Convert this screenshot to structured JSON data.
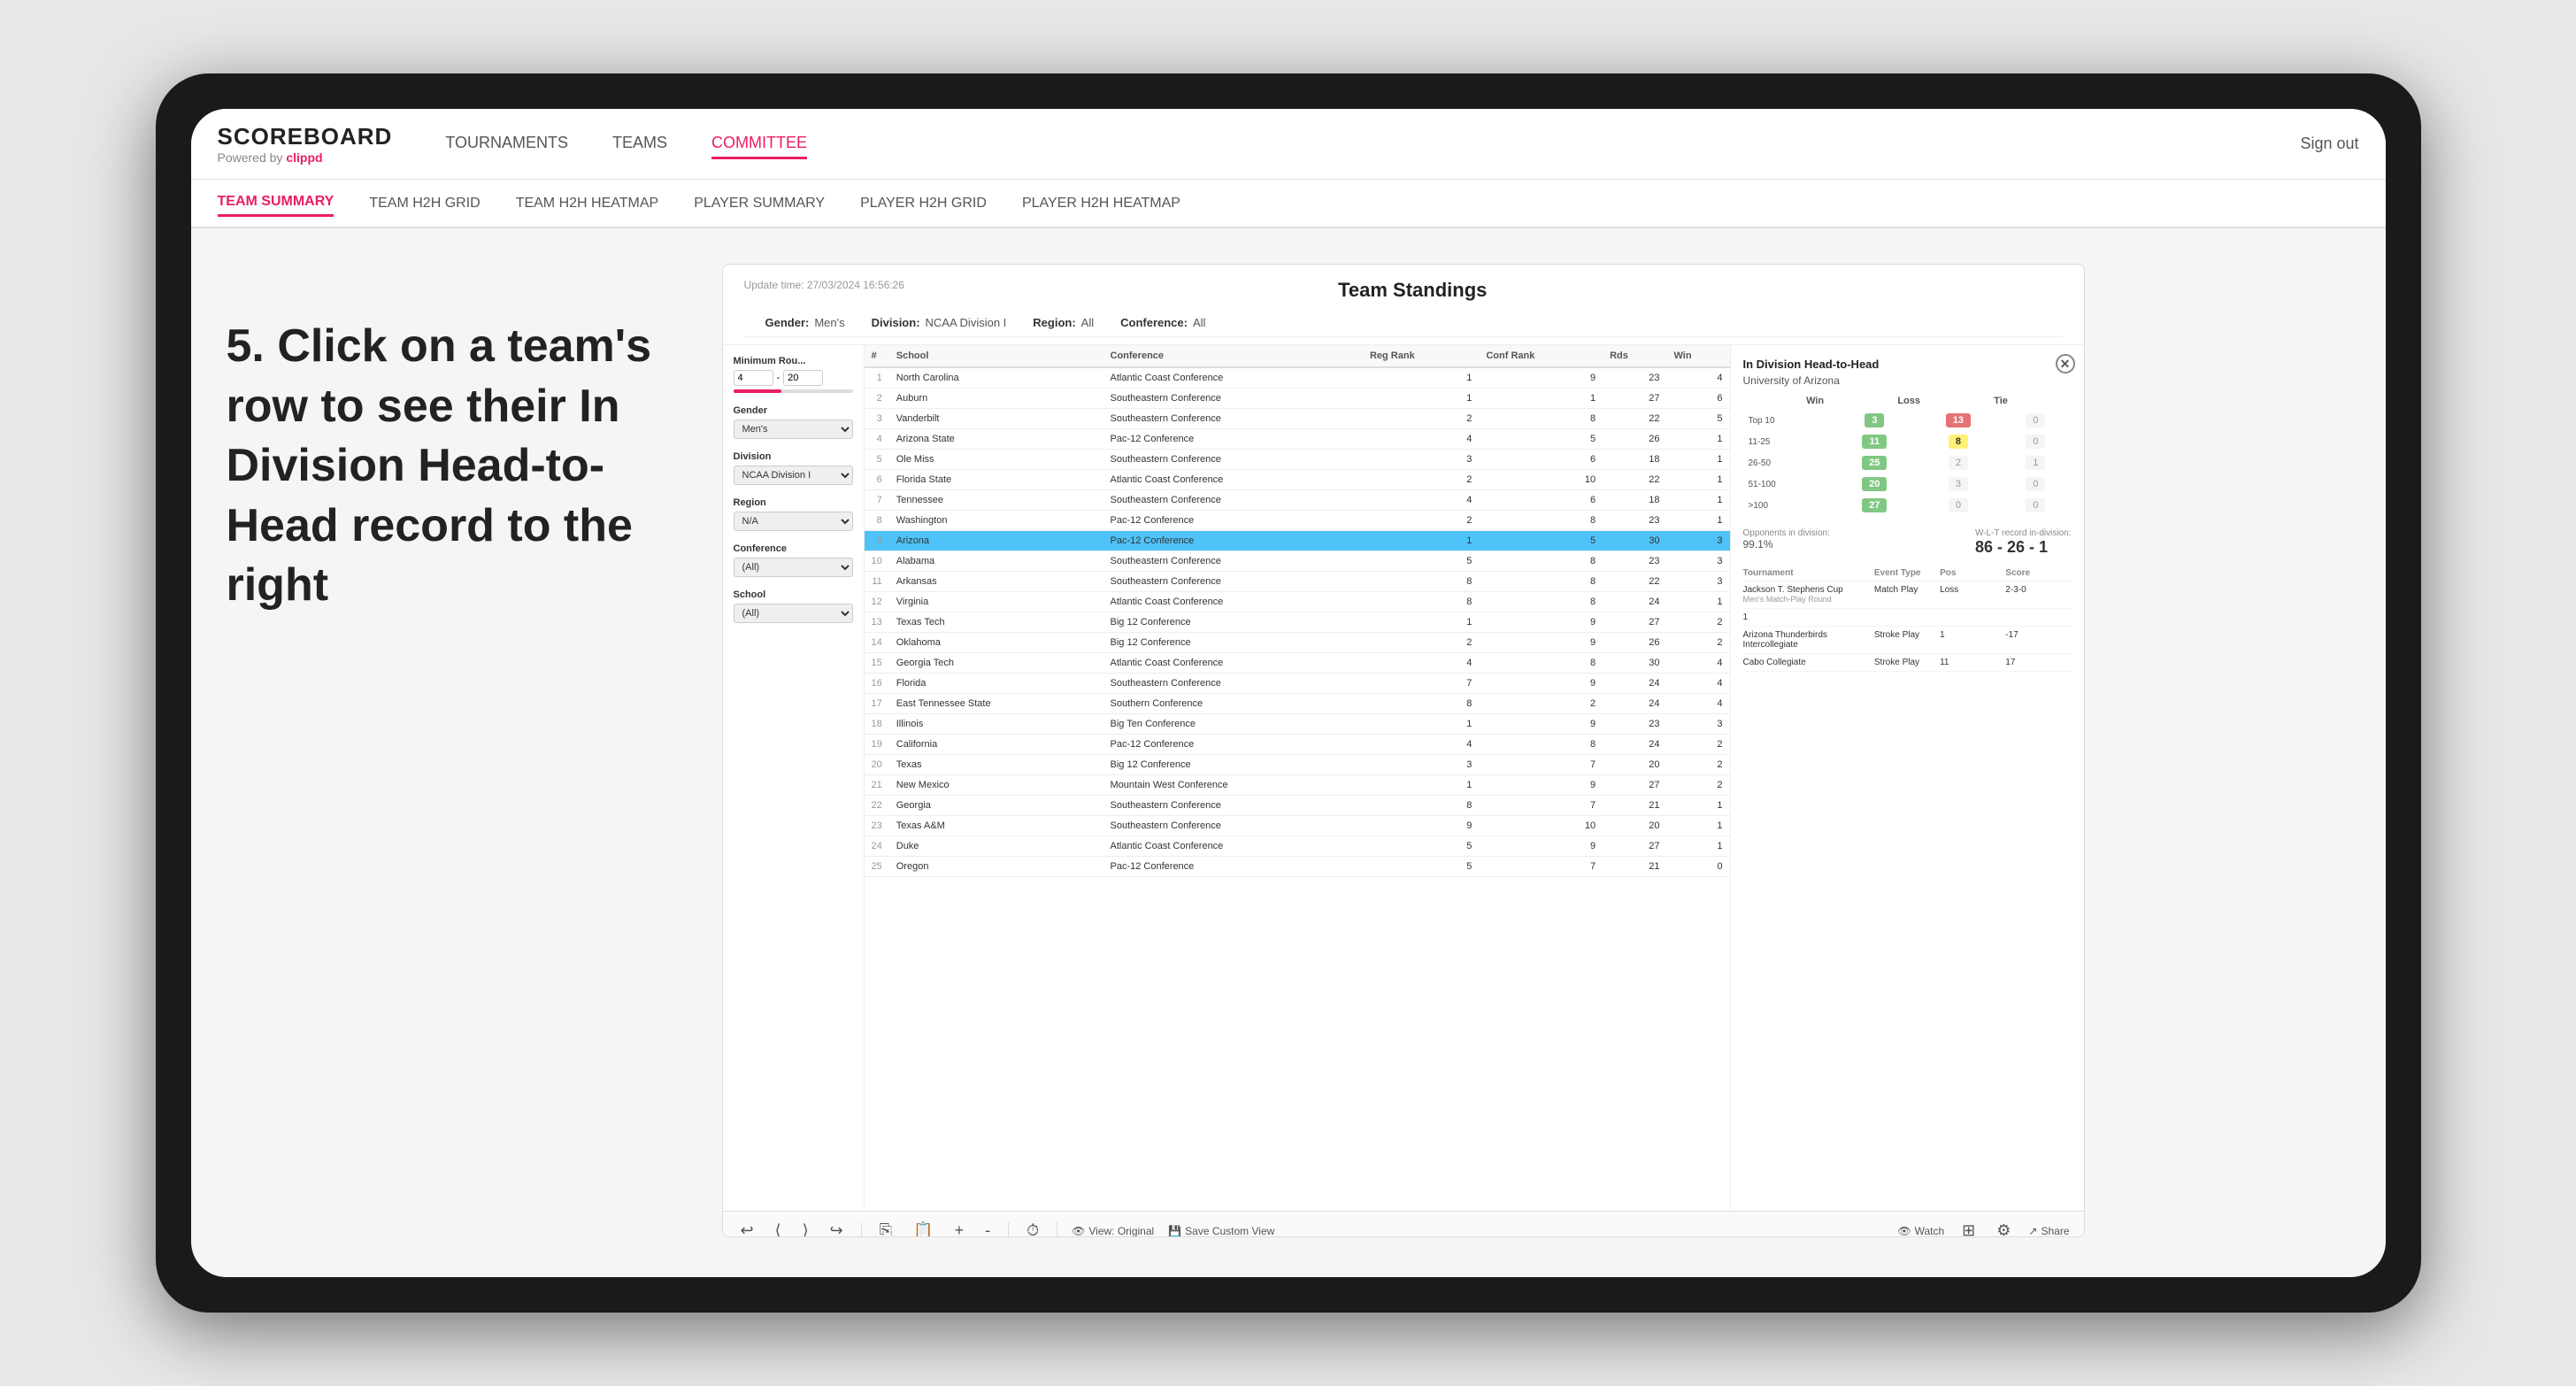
{
  "app": {
    "logo": "SCOREBOARD",
    "logo_sub": "Powered by",
    "logo_brand": "clippd",
    "sign_out": "Sign out"
  },
  "nav": {
    "links": [
      {
        "label": "TOURNAMENTS",
        "active": false
      },
      {
        "label": "TEAMS",
        "active": false
      },
      {
        "label": "COMMITTEE",
        "active": true
      }
    ]
  },
  "sub_nav": {
    "links": [
      {
        "label": "TEAM SUMMARY",
        "active": true
      },
      {
        "label": "TEAM H2H GRID",
        "active": false
      },
      {
        "label": "TEAM H2H HEATMAP",
        "active": false
      },
      {
        "label": "PLAYER SUMMARY",
        "active": false
      },
      {
        "label": "PLAYER H2H GRID",
        "active": false
      },
      {
        "label": "PLAYER H2H HEATMAP",
        "active": false
      }
    ]
  },
  "annotation": "5. Click on a team's row to see their In Division Head-to-Head record to the right",
  "panel": {
    "update_time": "Update time: 27/03/2024 16:56:26",
    "title": "Team Standings",
    "filters": {
      "gender": "Men's",
      "division": "NCAA Division I",
      "region": "All",
      "conference": "All"
    },
    "sidebar": {
      "min_rounds_label": "Minimum Rou...",
      "min_val": "4",
      "max_val": "20",
      "gender_label": "Gender",
      "gender_value": "Men's",
      "division_label": "Division",
      "division_value": "NCAA Division I",
      "region_label": "Region",
      "region_value": "N/A",
      "conference_label": "Conference",
      "conference_value": "(All)",
      "school_label": "School",
      "school_value": "(All)"
    },
    "table_headers": [
      "#",
      "School",
      "Conference",
      "Reg Rank",
      "Conf Rank",
      "Rds",
      "Win"
    ],
    "teams": [
      {
        "rank": 1,
        "school": "North Carolina",
        "conference": "Atlantic Coast Conference",
        "reg_rank": 1,
        "conf_rank": 9,
        "rds": 23,
        "win": 4
      },
      {
        "rank": 2,
        "school": "Auburn",
        "conference": "Southeastern Conference",
        "reg_rank": 1,
        "conf_rank": 1,
        "rds": 27,
        "win": 6
      },
      {
        "rank": 3,
        "school": "Vanderbilt",
        "conference": "Southeastern Conference",
        "reg_rank": 2,
        "conf_rank": 8,
        "rds": 22,
        "win": 5
      },
      {
        "rank": 4,
        "school": "Arizona State",
        "conference": "Pac-12 Conference",
        "reg_rank": 4,
        "conf_rank": 5,
        "rds": 26,
        "win": 1
      },
      {
        "rank": 5,
        "school": "Ole Miss",
        "conference": "Southeastern Conference",
        "reg_rank": 3,
        "conf_rank": 6,
        "rds": 18,
        "win": 1
      },
      {
        "rank": 6,
        "school": "Florida State",
        "conference": "Atlantic Coast Conference",
        "reg_rank": 2,
        "conf_rank": 10,
        "rds": 22,
        "win": 1
      },
      {
        "rank": 7,
        "school": "Tennessee",
        "conference": "Southeastern Conference",
        "reg_rank": 4,
        "conf_rank": 6,
        "rds": 18,
        "win": 1
      },
      {
        "rank": 8,
        "school": "Washington",
        "conference": "Pac-12 Conference",
        "reg_rank": 2,
        "conf_rank": 8,
        "rds": 23,
        "win": 1
      },
      {
        "rank": 9,
        "school": "Arizona",
        "conference": "Pac-12 Conference",
        "reg_rank": 1,
        "conf_rank": 5,
        "rds": 30,
        "win": 3,
        "selected": true
      },
      {
        "rank": 10,
        "school": "Alabama",
        "conference": "Southeastern Conference",
        "reg_rank": 5,
        "conf_rank": 8,
        "rds": 23,
        "win": 3
      },
      {
        "rank": 11,
        "school": "Arkansas",
        "conference": "Southeastern Conference",
        "reg_rank": 8,
        "conf_rank": 8,
        "rds": 22,
        "win": 3
      },
      {
        "rank": 12,
        "school": "Virginia",
        "conference": "Atlantic Coast Conference",
        "reg_rank": 8,
        "conf_rank": 8,
        "rds": 24,
        "win": 1
      },
      {
        "rank": 13,
        "school": "Texas Tech",
        "conference": "Big 12 Conference",
        "reg_rank": 1,
        "conf_rank": 9,
        "rds": 27,
        "win": 2
      },
      {
        "rank": 14,
        "school": "Oklahoma",
        "conference": "Big 12 Conference",
        "reg_rank": 2,
        "conf_rank": 9,
        "rds": 26,
        "win": 2
      },
      {
        "rank": 15,
        "school": "Georgia Tech",
        "conference": "Atlantic Coast Conference",
        "reg_rank": 4,
        "conf_rank": 8,
        "rds": 30,
        "win": 4
      },
      {
        "rank": 16,
        "school": "Florida",
        "conference": "Southeastern Conference",
        "reg_rank": 7,
        "conf_rank": 9,
        "rds": 24,
        "win": 4
      },
      {
        "rank": 17,
        "school": "East Tennessee State",
        "conference": "Southern Conference",
        "reg_rank": 8,
        "conf_rank": 2,
        "rds": 24,
        "win": 4
      },
      {
        "rank": 18,
        "school": "Illinois",
        "conference": "Big Ten Conference",
        "reg_rank": 1,
        "conf_rank": 9,
        "rds": 23,
        "win": 3
      },
      {
        "rank": 19,
        "school": "California",
        "conference": "Pac-12 Conference",
        "reg_rank": 4,
        "conf_rank": 8,
        "rds": 24,
        "win": 2
      },
      {
        "rank": 20,
        "school": "Texas",
        "conference": "Big 12 Conference",
        "reg_rank": 3,
        "conf_rank": 7,
        "rds": 20,
        "win": 2
      },
      {
        "rank": 21,
        "school": "New Mexico",
        "conference": "Mountain West Conference",
        "reg_rank": 1,
        "conf_rank": 9,
        "rds": 27,
        "win": 2
      },
      {
        "rank": 22,
        "school": "Georgia",
        "conference": "Southeastern Conference",
        "reg_rank": 8,
        "conf_rank": 7,
        "rds": 21,
        "win": 1
      },
      {
        "rank": 23,
        "school": "Texas A&M",
        "conference": "Southeastern Conference",
        "reg_rank": 9,
        "conf_rank": 10,
        "rds": 20,
        "win": 1
      },
      {
        "rank": 24,
        "school": "Duke",
        "conference": "Atlantic Coast Conference",
        "reg_rank": 5,
        "conf_rank": 9,
        "rds": 27,
        "win": 1
      },
      {
        "rank": 25,
        "school": "Oregon",
        "conference": "Pac-12 Conference",
        "reg_rank": 5,
        "conf_rank": 7,
        "rds": 21,
        "win": 0
      }
    ]
  },
  "h2h": {
    "title": "In Division Head-to-Head",
    "team": "University of Arizona",
    "col_headers": [
      "Win",
      "Loss",
      "Tie"
    ],
    "rows": [
      {
        "range": "Top 10",
        "win": 3,
        "loss": 13,
        "tie": 0,
        "win_color": "green",
        "loss_color": "red",
        "tie_color": "zero"
      },
      {
        "range": "11-25",
        "win": 11,
        "loss": 8,
        "tie": 0,
        "win_color": "green",
        "loss_color": "yellow",
        "tie_color": "zero"
      },
      {
        "range": "26-50",
        "win": 25,
        "loss": 2,
        "tie": 1,
        "win_color": "green",
        "loss_color": "zero",
        "tie_color": "zero"
      },
      {
        "range": "51-100",
        "win": 20,
        "loss": 3,
        "tie": 0,
        "win_color": "green",
        "loss_color": "zero",
        "tie_color": "zero"
      },
      {
        "range": ">100",
        "win": 27,
        "loss": 0,
        "tie": 0,
        "win_color": "green",
        "loss_color": "zero",
        "tie_color": "zero"
      }
    ],
    "opponents_pct": "99.1%",
    "opponents_label": "Opponents in division:",
    "record_label": "W-L-T record in-division:",
    "record": "86 - 26 - 1",
    "tournaments": {
      "header": [
        "Tournament",
        "Event Type",
        "Pos",
        "Score"
      ],
      "rows": [
        {
          "tournament": "Jackson T. Stephens Cup",
          "sub": "Men's Match-Play Round",
          "event_type": "Match Play",
          "pos": "Loss",
          "score": "2-3-0"
        },
        {
          "tournament": "1",
          "sub": "",
          "event_type": "",
          "pos": "",
          "score": ""
        },
        {
          "tournament": "Arizona Thunderbirds Intercollegiate",
          "sub": "",
          "event_type": "Stroke Play",
          "pos": "1",
          "score": "-17"
        },
        {
          "tournament": "Cabo Collegiate",
          "sub": "",
          "event_type": "Stroke Play",
          "pos": "11",
          "score": "17"
        }
      ]
    }
  },
  "toolbar": {
    "undo": "↩",
    "redo": "↪",
    "view_original": "View: Original",
    "save_custom": "Save Custom View",
    "watch": "Watch",
    "share": "Share"
  }
}
